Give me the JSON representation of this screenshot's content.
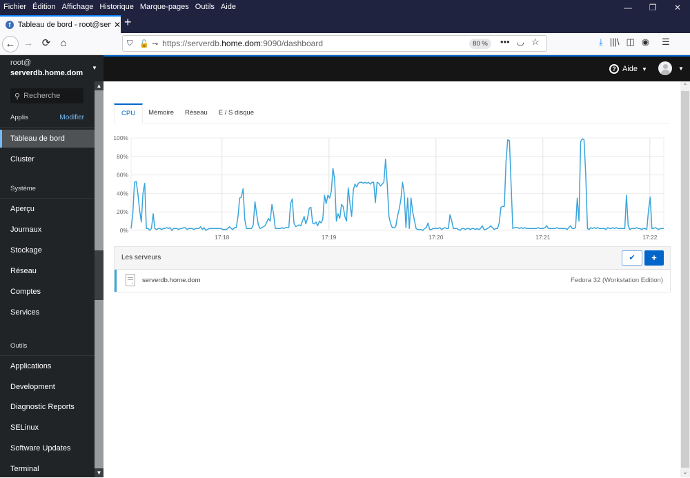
{
  "browser": {
    "menu": [
      "Fichier",
      "Édition",
      "Affichage",
      "Historique",
      "Marque-pages",
      "Outils",
      "Aide"
    ],
    "window_controls": {
      "minimize": "—",
      "restore": "❐",
      "close": "✕"
    },
    "tab": {
      "title": "Tableau de bord - root@serverdb.home.dom",
      "favicon": "f",
      "close": "✕"
    },
    "new_tab": "+",
    "nav": {
      "back": "←",
      "forward": "→",
      "reload": "⟳",
      "home": "⌂"
    },
    "url": {
      "prefix": "https://serverdb.",
      "domain": "home.dom",
      "suffix": ":9090/dashboard"
    },
    "zoom_level": "80 %",
    "url_icons": {
      "more": "•••",
      "pocket": "◡",
      "bookmark": "☆"
    },
    "toolbar_icons": {
      "download": "⤓",
      "library": "|||\\",
      "sidebar": "◫",
      "account": "◉",
      "menu": "☰"
    }
  },
  "sidebar": {
    "user": "root@",
    "host": "serverdb.home.dom",
    "search_placeholder": "Recherche",
    "apps_header": "Applis",
    "modify": "Modifier",
    "apps": [
      {
        "label": "Tableau de bord",
        "active": true
      },
      {
        "label": "Cluster",
        "active": false
      }
    ],
    "system_header": "Système",
    "system": [
      "Aperçu",
      "Journaux",
      "Stockage",
      "Réseau",
      "Comptes",
      "Services"
    ],
    "tools_header": "Outils",
    "tools": [
      "Applications",
      "Development",
      "Diagnostic Reports",
      "SELinux",
      "Software Updates",
      "Terminal"
    ]
  },
  "topbar": {
    "help": "Aide"
  },
  "tabs": [
    {
      "label": "CPU",
      "active": true
    },
    {
      "label": "Mémoire",
      "active": false
    },
    {
      "label": "Réseau",
      "active": false
    },
    {
      "label": "E / S disque",
      "active": false
    }
  ],
  "servers": {
    "title": "Les serveurs",
    "rows": [
      {
        "name": "serverdb.home.dom",
        "os": "Fedora 32 (Workstation Edition)"
      }
    ]
  },
  "colors": {
    "accent": "#0066cc",
    "series": "#39a5dc",
    "sidebar_bg": "#212427",
    "active_border": "#73bcf7"
  },
  "chart_data": {
    "type": "line",
    "title": "CPU",
    "xlabel": "",
    "ylabel": "",
    "ylim": [
      0,
      100
    ],
    "yticks": [
      "0%",
      "20%",
      "40%",
      "60%",
      "80%",
      "100%"
    ],
    "xticks": [
      "17:18",
      "17:19",
      "17:20",
      "17:21",
      "17:22"
    ],
    "x_range_minutes": [
      -0.85,
      4.13
    ],
    "xtick_minutes": [
      0,
      1,
      2,
      3,
      4
    ],
    "grid": true,
    "series": [
      {
        "name": "CPU",
        "values": [
          2,
          18,
          52,
          53,
          40,
          22,
          9,
          40,
          51,
          2,
          2,
          0,
          2,
          18,
          2,
          1,
          2,
          2,
          1,
          2,
          2,
          3,
          2,
          3,
          0,
          2,
          2,
          2,
          1,
          2,
          2,
          3,
          3,
          1,
          2,
          2,
          2,
          1,
          2,
          2,
          2,
          4,
          1,
          3,
          0,
          1,
          2,
          2,
          2,
          2,
          2,
          2,
          2,
          2,
          1,
          1,
          1,
          2,
          4,
          2,
          1,
          3,
          3,
          15,
          35,
          36,
          45,
          12,
          2,
          2,
          2,
          2,
          6,
          31,
          18,
          6,
          2,
          3,
          4,
          5,
          9,
          13,
          10,
          28,
          18,
          2,
          2,
          2,
          2,
          3,
          2,
          3,
          3,
          3,
          29,
          34,
          8,
          4,
          5,
          6,
          5,
          10,
          15,
          7,
          13,
          24,
          25,
          8,
          7,
          9,
          5,
          10,
          8,
          12,
          38,
          29,
          38,
          35,
          42,
          67,
          55,
          10,
          18,
          13,
          28,
          26,
          15,
          10,
          46,
          29,
          15,
          44,
          50,
          47,
          51,
          52,
          52,
          51,
          52,
          51,
          52,
          50,
          52,
          52,
          30,
          52,
          51,
          48,
          50,
          52,
          77,
          50,
          15,
          7,
          3,
          3,
          4,
          15,
          23,
          33,
          52,
          40,
          3,
          35,
          2,
          35,
          20,
          11,
          2,
          1,
          1,
          1,
          0,
          2,
          3,
          8,
          1,
          1,
          2,
          2,
          2,
          2,
          3,
          1,
          2,
          3,
          2,
          2,
          17,
          10,
          2,
          2,
          2,
          1,
          0,
          2,
          2,
          1,
          2,
          2,
          1,
          2,
          2,
          1,
          2,
          1,
          2,
          5,
          1,
          1,
          2,
          3,
          5,
          3,
          1,
          2,
          2,
          8,
          25,
          26,
          26,
          75,
          98,
          97,
          50,
          2,
          3,
          3,
          3,
          2,
          3,
          2,
          3,
          2,
          2,
          2,
          2,
          2,
          2,
          2,
          3,
          2,
          2,
          2,
          3,
          5,
          2,
          2,
          2,
          2,
          2,
          3,
          2,
          2,
          2,
          2,
          2,
          1,
          3,
          5,
          2,
          2,
          3,
          35,
          10,
          96,
          99,
          98,
          60,
          2,
          1,
          3,
          2,
          3,
          2,
          3,
          2,
          2,
          2,
          2,
          1,
          3,
          2,
          2,
          3,
          2,
          3,
          2,
          2,
          2,
          2,
          2,
          38,
          5,
          1,
          2,
          2,
          2,
          3,
          2,
          2,
          1,
          2,
          2,
          1,
          22,
          36,
          2,
          2,
          3,
          2,
          1,
          2,
          2,
          2
        ]
      }
    ]
  }
}
